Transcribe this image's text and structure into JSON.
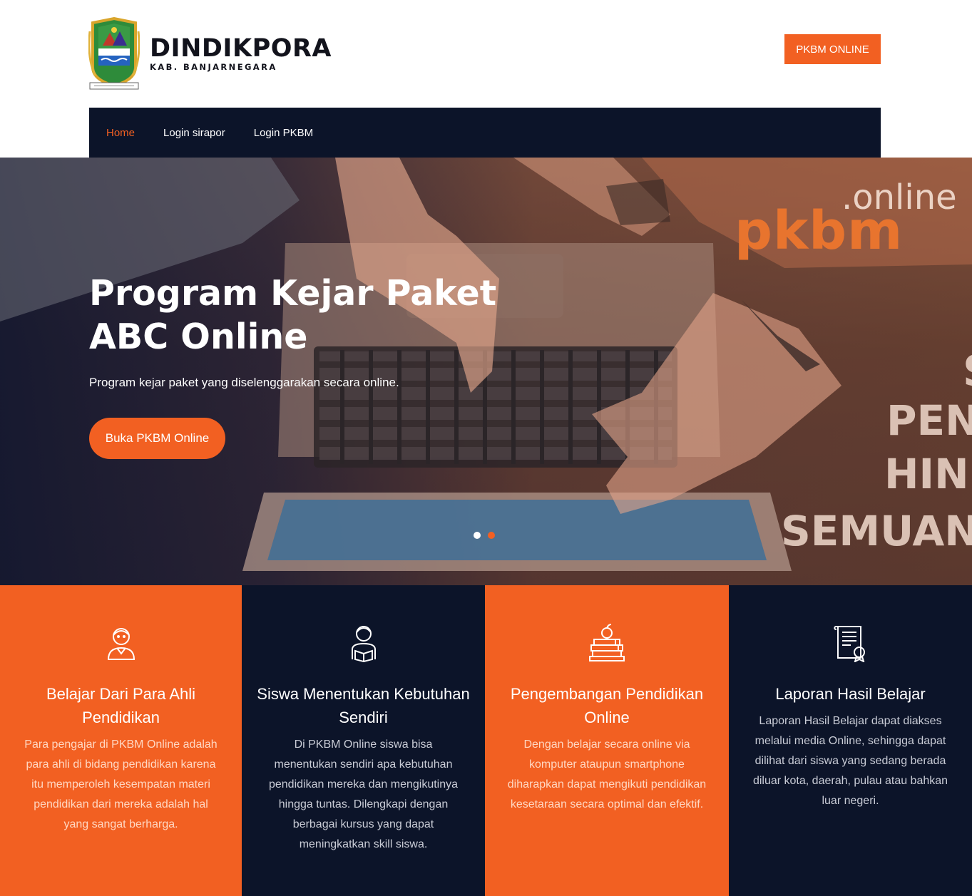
{
  "header": {
    "brand_title": "DINDIKPORA",
    "brand_sub": "KAB. BANJARNEGARA",
    "cta_label": "PKBM ONLINE"
  },
  "nav": {
    "items": [
      {
        "label": "Home",
        "active": true
      },
      {
        "label": "Login sirapor",
        "active": false
      },
      {
        "label": "Login PKBM",
        "active": false
      }
    ]
  },
  "hero": {
    "title": "Program Kejar Paket ABC Online",
    "subtitle": "Program kejar paket yang diselenggarakan secara online.",
    "button_label": "Buka PKBM Online",
    "slides": 2,
    "active_slide": 2,
    "promo": {
      "online": ".online",
      "pkbm": "pkbm",
      "s": "S",
      "line1": "PEN",
      "line2": "HIN",
      "line3": "SEMUAN"
    }
  },
  "features": [
    {
      "icon": "teacher-icon",
      "title": "Belajar Dari Para Ahli Pendidikan",
      "text": "Para pengajar di PKBM Online adalah para ahli di bidang pendidikan karena itu memperoleh kesempatan materi pendidikan dari mereka adalah hal yang sangat berharga.",
      "color": "#f26022"
    },
    {
      "icon": "student-reading-icon",
      "title": "Siswa Menentukan Kebutuhan Sendiri",
      "text": "Di PKBM Online siswa bisa menentukan sendiri apa kebutuhan pendidikan mereka dan mengikutinya hingga tuntas. Dilengkapi dengan berbagai kursus yang dapat meningkatkan skill siswa.",
      "color": "#0c1429"
    },
    {
      "icon": "books-apple-icon",
      "title": "Pengembangan Pendidikan Online",
      "text": "Dengan belajar secara online via komputer ataupun smartphone diharapkan dapat mengikuti pendidikan kesetaraan secara optimal dan efektif.",
      "color": "#f26022"
    },
    {
      "icon": "certificate-icon",
      "title": "Laporan Hasil Belajar",
      "text": "Laporan Hasil Belajar dapat diakses melalui media Online, sehingga dapat dilihat dari siswa yang sedang berada diluar kota, daerah, pulau atau bahkan luar negeri.",
      "color": "#0c1429"
    }
  ],
  "colors": {
    "accent": "#f26022",
    "navy": "#0c1429"
  }
}
